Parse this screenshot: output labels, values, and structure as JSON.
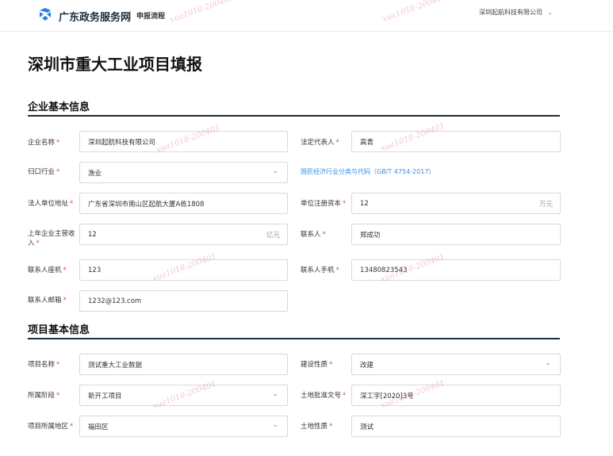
{
  "header": {
    "brand": "广东政务服务网",
    "sub": "申报流程",
    "user": "深圳起航科技有限公司"
  },
  "page_title": "深圳市重大工业项目填报",
  "sections": {
    "company": "企业基本信息",
    "project": "项目基本信息"
  },
  "company": {
    "name_label": "企业名称",
    "name_value": "深圳起航科技有限公司",
    "legal_rep_label": "法定代表人",
    "legal_rep_value": "高青",
    "industry_label": "归口行业",
    "industry_value": "渔业",
    "industry_hint": "国民经济行业分类与代码（GB/T 4754-2017）",
    "address_label": "法人单位地址",
    "address_value": "广东省深圳市南山区起航大厦A栋1808",
    "capital_label": "单位注册资本",
    "capital_value": "12",
    "capital_unit": "万元",
    "revenue_label": "上年企业主营收入",
    "revenue_value": "12",
    "revenue_unit": "亿元",
    "contact_label": "联系人",
    "contact_value": "郑成功",
    "landline_label": "联系人座机",
    "landline_value": "123",
    "mobile_label": "联系人手机",
    "mobile_value": "13480823543",
    "email_label": "联系人邮箱",
    "email_value": "1232@123.com"
  },
  "project": {
    "name_label": "项目名称",
    "name_value": "测试重大工业数据",
    "nature_label": "建设性质",
    "nature_value": "改建",
    "stage_label": "所属阶段",
    "stage_value": "新开工项目",
    "land_doc_label": "土地批准文号",
    "land_doc_value": "深工字[2020]3号",
    "district_label": "项目所属地区",
    "district_value": "福田区",
    "land_nature_label": "土地性质",
    "land_nature_value": "测试"
  },
  "watermark": "xua1018-200401",
  "colors": {
    "required": "#e5484d",
    "link": "#3a8ee6",
    "section_rule": "#1f2d3d",
    "logo": "#2f7de1"
  }
}
